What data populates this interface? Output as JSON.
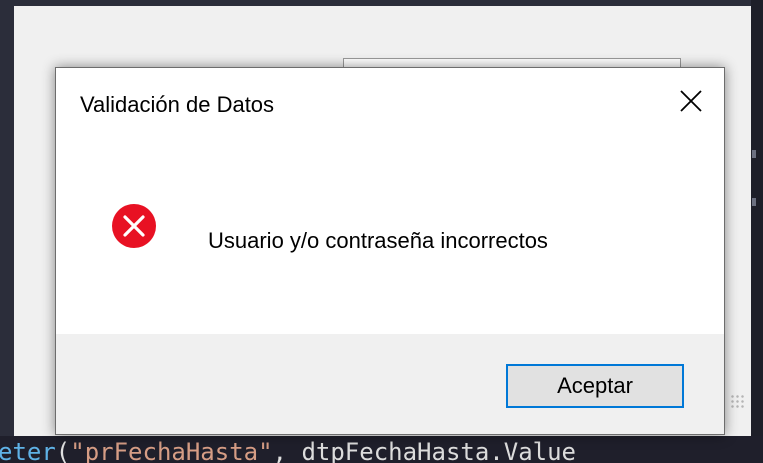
{
  "dialog": {
    "title": "Validación de Datos",
    "message": "Usuario y/o contraseña incorrectos",
    "ok_label": "Aceptar",
    "close_icon": "close-icon",
    "status_icon": "error-icon"
  },
  "code_editor": {
    "method_fragment": "eter",
    "open_paren": "(",
    "string_literal": "\"prFechaHasta\"",
    "separator": ", ",
    "identifier": "dtpFechaHasta.Value"
  },
  "colors": {
    "error_red": "#e81123",
    "focus_border": "#0078d7",
    "dialog_footer": "#f0f0f0"
  }
}
